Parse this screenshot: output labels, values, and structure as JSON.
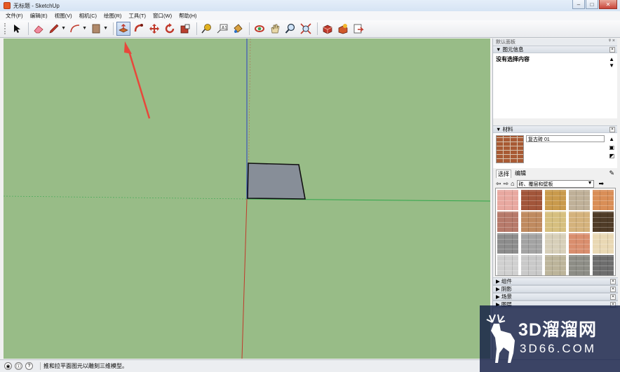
{
  "window": {
    "title": "无标题 - SketchUp",
    "minimize": "–",
    "maximize": "□",
    "close": "✕"
  },
  "menu": [
    "文件(F)",
    "编辑(E)",
    "视图(V)",
    "相机(C)",
    "绘图(R)",
    "工具(T)",
    "窗口(W)",
    "帮助(H)"
  ],
  "toolbar": {
    "active_tool": "push-pull",
    "tools": [
      "select",
      "eraser",
      "pencil",
      "arc",
      "rectangle",
      "push-pull",
      "follow-me",
      "move",
      "rotate",
      "scale",
      "tape-measure",
      "text",
      "paint-bucket",
      "orbit",
      "pan",
      "zoom",
      "zoom-extents",
      "warehouse-get",
      "warehouse-share",
      "send-to-layout"
    ]
  },
  "tray": {
    "title": "默认面板",
    "pin": "ᵠ",
    "close": "×",
    "entity_info": {
      "header": "图元信息",
      "empty_label": "没有选择内容"
    },
    "materials": {
      "header": "材料",
      "current_name": "复古砖 01",
      "tab_select": "选择",
      "tab_edit": "编辑",
      "collection": "砖、覆层和壁板"
    },
    "collapsed": [
      "组件",
      "阴影",
      "场景",
      "图层"
    ]
  },
  "status": {
    "hint": "推和拉平面图元以雕刻三维模型。"
  },
  "watermark": {
    "line1": "3D溜溜网",
    "line2": "3D66.COM"
  },
  "colors": {
    "ground": "#98bc87",
    "face": "#878e98",
    "red_axis": "#c0392b",
    "green_axis": "#2fa64a",
    "blue_axis": "#2b3fc4",
    "arrow": "#e8473b"
  },
  "swatch_colors": [
    [
      "#e8a8a0",
      "#a2553a",
      "#c99a4c",
      "#bfb098",
      "#d98e57"
    ],
    [
      "#b6796a",
      "#bf8a5f",
      "#d6bf7f",
      "#d4b27c",
      "#4f3b27"
    ],
    [
      "#8c8c8c",
      "#a3a3a3",
      "#d7cfb9",
      "#d98e6e",
      "#e9d8b4"
    ],
    [
      "#d0d0d0",
      "#c9c9c9",
      "#bcb49a",
      "#8d8d86",
      "#6d6d6d"
    ]
  ]
}
